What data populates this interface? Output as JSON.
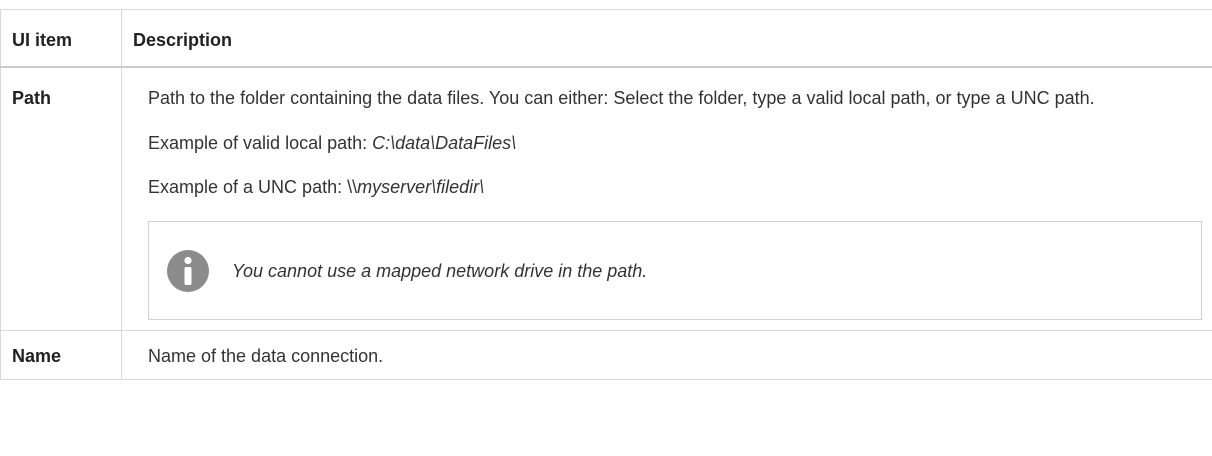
{
  "table": {
    "headers": {
      "item": "UI item",
      "description": "Description"
    },
    "rows": [
      {
        "item": "Path",
        "desc_line1": "Path to the folder containing the data files. You can either: Select the folder, type a valid local path, or type a UNC path.",
        "local_prefix": "Example of valid local path: ",
        "local_value": "C:\\data\\DataFiles\\",
        "unc_prefix": "Example of a UNC path: ",
        "unc_value_start": "\\\\",
        "unc_value_rest": "myserver\\filedir\\",
        "note_icon": "info-icon",
        "note": "You cannot use a mapped network drive in the path."
      },
      {
        "item": "Name",
        "description": "Name of the data connection."
      }
    ]
  },
  "colors": {
    "border": "#d8d8d8",
    "note_icon": "#8c8c8c",
    "text": "#333333"
  }
}
